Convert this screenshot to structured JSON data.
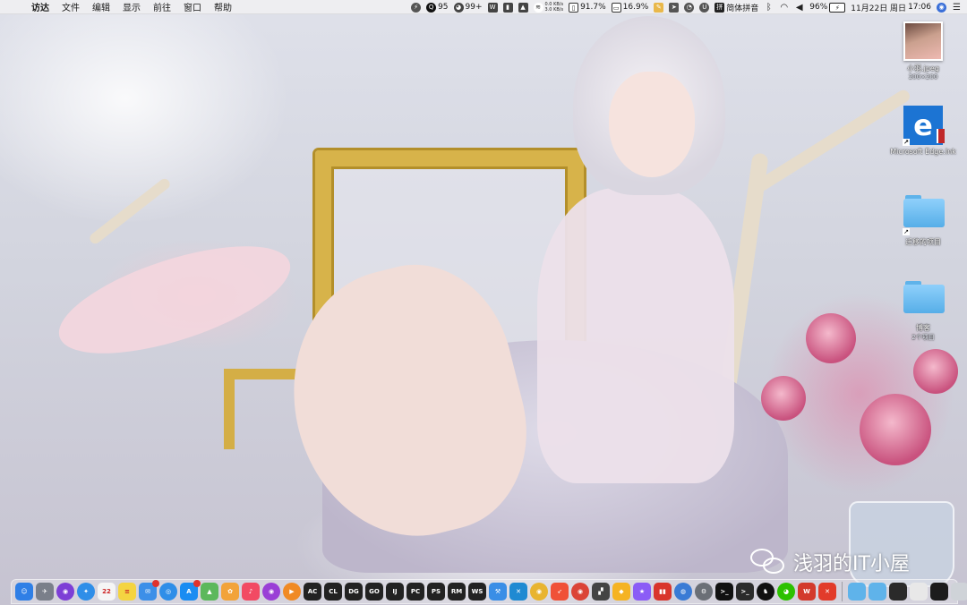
{
  "menubar": {
    "apple_glyph": "",
    "items": [
      "访达",
      "文件",
      "编辑",
      "显示",
      "前往",
      "窗口",
      "帮助"
    ],
    "status": {
      "qq_count": "95",
      "wechat_count": "99+",
      "net_up": "0.0 KB/s",
      "net_down": "3.0 KB/s",
      "cpu": "91.7%",
      "memory": "16.9%",
      "input_method": "简体拼音",
      "battery": "96%",
      "date": "11月22日 周日",
      "time": "17:06"
    }
  },
  "desktop_icons": [
    {
      "name": "小羽.jpeg",
      "sub": "200×200",
      "type": "photo"
    },
    {
      "name": "Microsoft Edge.lnk",
      "sub": "",
      "type": "edge"
    },
    {
      "name": "迁移的项目",
      "sub": "",
      "type": "folder"
    },
    {
      "name": "博客",
      "sub": "2个项目",
      "type": "folder"
    }
  ],
  "watermark": {
    "text": "浅羽的IT小屋"
  },
  "dock": {
    "apps": [
      {
        "icon": "finder-icon",
        "label": "☺",
        "color": "#2f7fe6"
      },
      {
        "icon": "launchpad-icon",
        "label": "✈",
        "color": "#7a7f8a"
      },
      {
        "icon": "siri-icon",
        "label": "◉",
        "color": "#7d3fd6"
      },
      {
        "icon": "safari-icon",
        "label": "✦",
        "color": "#2f8ee8"
      },
      {
        "icon": "calendar-icon",
        "label": "22",
        "color": "#f5f5f5"
      },
      {
        "icon": "notes-icon",
        "label": "≡",
        "color": "#f4d441"
      },
      {
        "icon": "mail-icon",
        "label": "✉",
        "color": "#3c8fe8"
      },
      {
        "icon": "safari-icon",
        "label": "◎",
        "color": "#2f8ee8"
      },
      {
        "icon": "app-store-icon",
        "label": "A",
        "color": "#1a8cf2"
      },
      {
        "icon": "maps-icon",
        "label": "▲",
        "color": "#5cb85c"
      },
      {
        "icon": "photos-icon",
        "label": "✿",
        "color": "#f2a33a"
      },
      {
        "icon": "music-icon",
        "label": "♪",
        "color": "#f24a63"
      },
      {
        "icon": "podcasts-icon",
        "label": "◉",
        "color": "#9a3fd6"
      },
      {
        "icon": "video-player-icon",
        "label": "▶",
        "color": "#f08a24"
      },
      {
        "icon": "appcode-icon",
        "label": "AC",
        "color": "#222"
      },
      {
        "icon": "clion-icon",
        "label": "CL",
        "color": "#222"
      },
      {
        "icon": "datagrip-icon",
        "label": "DG",
        "color": "#222"
      },
      {
        "icon": "goland-icon",
        "label": "GO",
        "color": "#222"
      },
      {
        "icon": "intellij-icon",
        "label": "IJ",
        "color": "#222"
      },
      {
        "icon": "pycharm-icon",
        "label": "PC",
        "color": "#222"
      },
      {
        "icon": "phpstorm-icon",
        "label": "PS",
        "color": "#222"
      },
      {
        "icon": "rubymine-icon",
        "label": "RM",
        "color": "#222"
      },
      {
        "icon": "webstorm-icon",
        "label": "WS",
        "color": "#222"
      },
      {
        "icon": "xcode-icon",
        "label": "⚒",
        "color": "#3a8ee6"
      },
      {
        "icon": "vscode-icon",
        "label": "✕",
        "color": "#1f8ad2"
      },
      {
        "icon": "chrome-icon",
        "label": "◉",
        "color": "#e8b430"
      },
      {
        "icon": "swift-icon",
        "label": "➶",
        "color": "#f05138"
      },
      {
        "icon": "chrome-icon",
        "label": "◉",
        "color": "#db4437"
      },
      {
        "icon": "clapper-icon",
        "label": "▞",
        "color": "#444"
      },
      {
        "icon": "sketch-icon",
        "label": "◆",
        "color": "#f5b323"
      },
      {
        "icon": "star-icon",
        "label": "★",
        "color": "#8b5cf6"
      },
      {
        "icon": "parallels-icon",
        "label": "▮▮",
        "color": "#d9352c"
      },
      {
        "icon": "network-icon",
        "label": "◍",
        "color": "#3a7bd5"
      },
      {
        "icon": "system-preferences-icon",
        "label": "⚙",
        "color": "#6b6f76"
      },
      {
        "icon": "terminal-icon",
        "label": ">_",
        "color": "#111"
      },
      {
        "icon": "terminal-icon",
        "label": ">_",
        "color": "#2b2b2b"
      },
      {
        "icon": "qq-icon",
        "label": "♞",
        "color": "#111"
      },
      {
        "icon": "wechat-icon",
        "label": "◕",
        "color": "#2dc100"
      },
      {
        "icon": "wps-icon",
        "label": "W",
        "color": "#d33a2c"
      },
      {
        "icon": "xmind-icon",
        "label": "✕",
        "color": "#e23b2a"
      }
    ],
    "stack": [
      {
        "icon": "folder-icon",
        "color": "#5fb3ea"
      },
      {
        "icon": "folder-icon",
        "color": "#5fb3ea"
      },
      {
        "icon": "screenshot-icon",
        "color": "#2a2a2a"
      },
      {
        "icon": "window-icon",
        "color": "#e8e8e8"
      },
      {
        "icon": "window-icon",
        "color": "#1c1c1c"
      },
      {
        "icon": "trash-icon",
        "color": "#cfd3d8"
      }
    ]
  }
}
